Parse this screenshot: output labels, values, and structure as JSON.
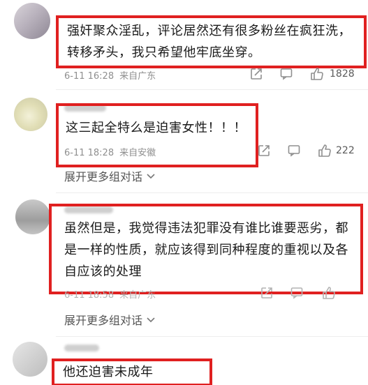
{
  "comments": [
    {
      "text": "强奸聚众淫乱，评论居然还有很多粉丝在疯狂洗，转移矛头，我只希望他牢底坐穿。",
      "time": "6-11 16:28",
      "location": "来自广东",
      "likes": "1828"
    },
    {
      "text": "这三起全特么是迫害女性！！！",
      "time": "6-11 18:28",
      "location": "来自安徽",
      "likes": "222",
      "expand_label": "展开更多组对话"
    },
    {
      "text": "虽然但是，我觉得违法犯罪没有谁比谁要恶劣，都是一样的性质，就应该得到同种程度的重视以及各自应该的处理",
      "time": "6-11 18:58",
      "location": "来自广东",
      "expand_label": "展开更多组对话"
    },
    {
      "text": "他还迫害未成年"
    }
  ],
  "colors": {
    "highlight_box": "#e02020",
    "meta_text": "#8f8f8f"
  },
  "icons": [
    "share-icon",
    "comment-icon",
    "like-icon",
    "chevron-down-icon"
  ]
}
